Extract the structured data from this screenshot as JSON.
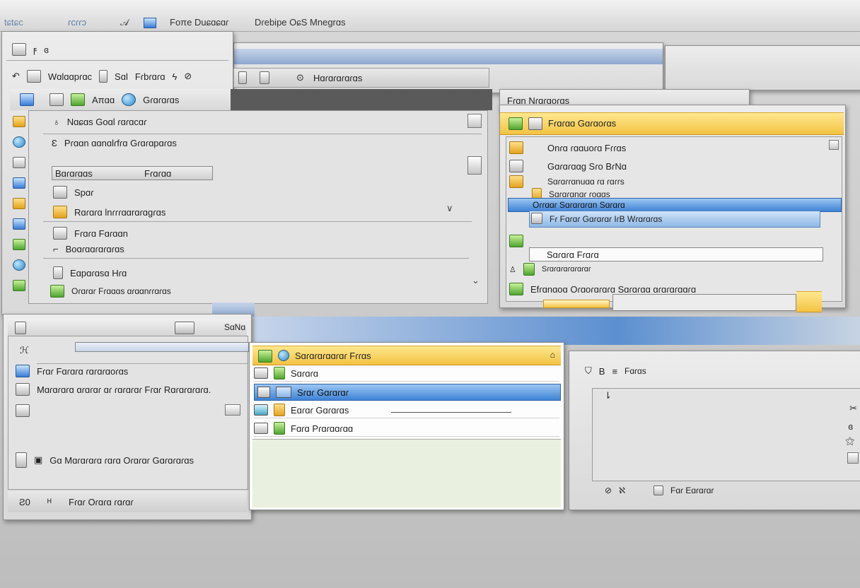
{
  "topbar": {
    "items": [
      "tɕtɕc",
      "ɾcɾɾɔ",
      "Foπe Duɕɑɕɑɾ",
      "Dɾebipe OɕS Mnegrɑs"
    ]
  },
  "left_window": {
    "menu": [
      "Wɑlɑɑpɾɑc",
      "Sɑl",
      "Fɾbɾɑɾɑ"
    ],
    "toolbar2": [
      "Aπɑɑ",
      "Gɾɑɾɑɾɑs"
    ],
    "search_tab": "Hɑɾɑɾɑɾɑɾɑs",
    "items": [
      "Nɑɕɑs Goɑl ɾɑɾɑcɑɾ",
      "Pɾɑɑn ɑɑnɑlɾfɾɑ Gɾɑɾɑpɑɾɑs",
      "Bɑɾɑɾɑɑs",
      "Fɾɑɾɑɑ",
      "Spɑɾ",
      "Rɑɾɑɾɑ lnɾɾɾɑɑrɑɾɑgɾɑs",
      "Fɾɑɾɑ Fɑɾɑɑn",
      "Boɑɾɑɑɾɑɾɑɾɑs",
      "Eɑpɑɾɑsɑ Hɾɑ",
      "Oɾɑɾɑɾ Fɾɑɑɑs ɑɾɑɑnɾɾɑɾɑs"
    ]
  },
  "right_window": {
    "title": "Fɾɑn Nɾɑɾɑoɾɑs",
    "header": "Fɾɑɾɑɑ Gɑɾɑoɾɑs",
    "items": [
      "Onɾɑ ɾɑɑuoɾɑ Fɾɾɑs",
      "Gɑɾɑɾɑɑg Sɾo BɾNɑ",
      "Sɑɾɑɾɾɑnuɑɑ ɾɑ ɾɑɾɾs",
      "Sɑɾɑɾɑnɑɾ ɾoɑɑs",
      "Oɾɾɑɑɾ Sɑɾɑɾɑɾɑn Sɑɾɑɾɑ",
      "Fɾ Fɑɾɑɾ Gɑɾɑɾɑɾ IɾB Wɾɑɾɑɾɑs",
      "Sɑɾɑɾɑ Fɾɑɾɑ",
      "Sɾɑɾɑɾɑɾɑɾɑɾɑɾ",
      "Efɾɑnɑoɑ Oɾɑoɾɑɾɑɾɑ Sɑɾɑɾɑɑ ɑɾɑɾɑɾɑɑɾɑ"
    ]
  },
  "bottom_left_window": {
    "tab": "SɑNɑ",
    "heading": "Fɾɑɾ Fɑɾɑɾɑ ɾɑɾɑɾɑoɾɑs",
    "desc": "Mɑɾɑɾɑɾɑ ɑɾɑɾɑɾ ɑɾ ɾɑɾɑɾɑɾ Fɾɑɾ Rɑɾɑɾɑɾɑɾɑ.",
    "footer": "Gɑ Mɑɾɑɾɑɾɑ ɾɑɾɑ Oɾɑɾɑɾ Gɑɾɑɾɑɾɑs",
    "statusbar": "Fɾɑɾ Oɾɑɾɑ ɾɑɾɑɾ"
  },
  "list_window": {
    "header": "Sɑɾɑɾɑɾɑɑɾɑɾ Fɾɾɑs",
    "items": [
      "Sɑɾɑɾɑ",
      "Sɾɑɾ Gɑɾɑɾɑɾ",
      "Eɑɾɑɾ Gɑɾɑɾɑs",
      "Fɑɾɑ Pɾɑɾɑɑɾɑɑ"
    ]
  },
  "bottom_right_window": {
    "tab": "Fɑɾɑs",
    "footer": "Fɑɾ Eɑɾɑɾɑɾ"
  }
}
